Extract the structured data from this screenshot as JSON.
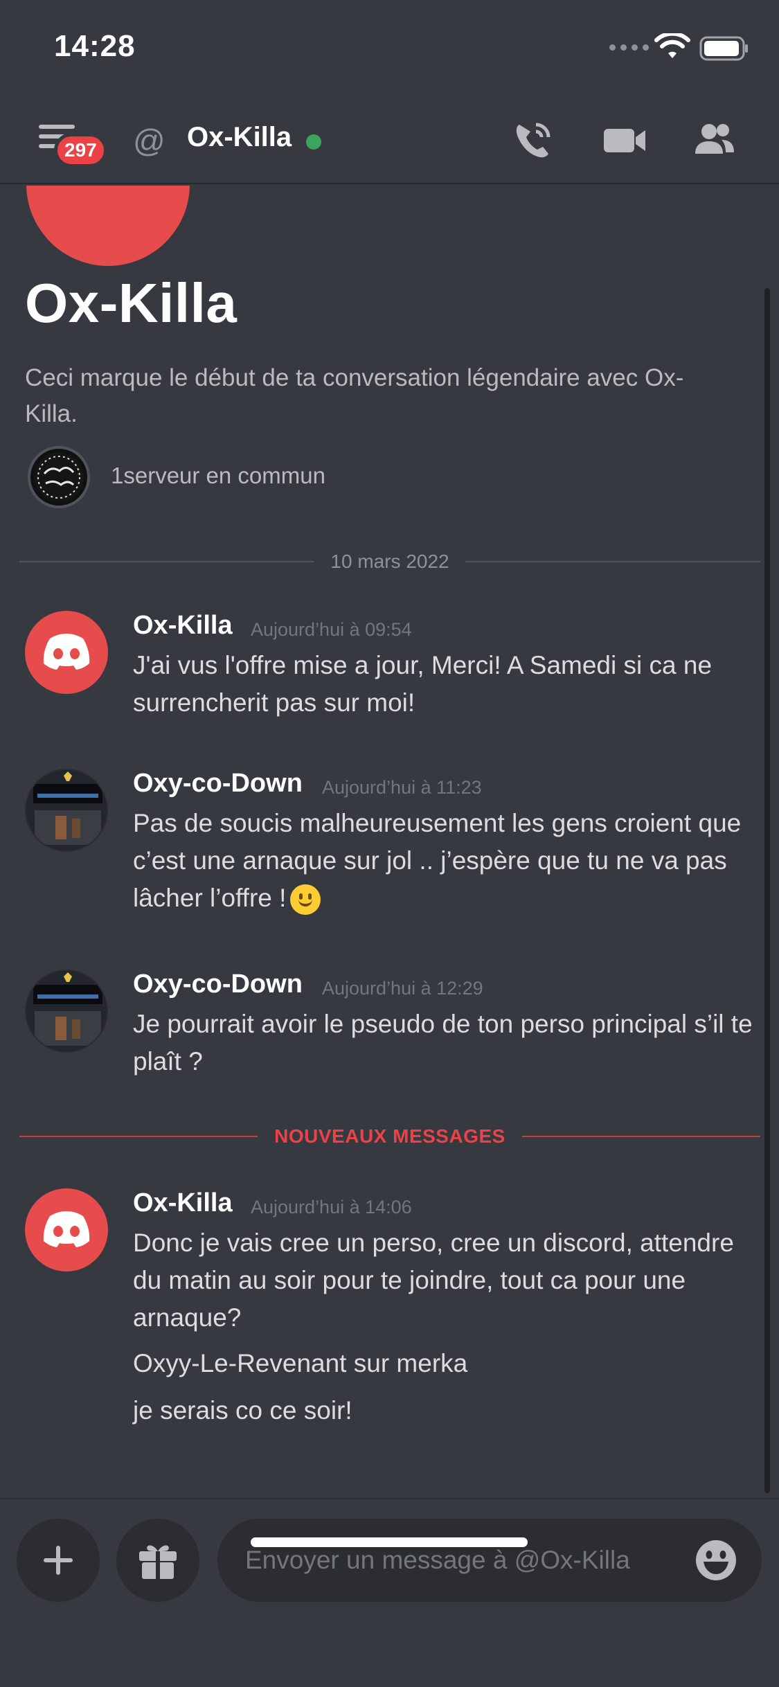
{
  "status_bar": {
    "time": "14:28"
  },
  "header": {
    "badge_count": "297",
    "at_symbol": "@",
    "name": "Ox-Killa",
    "icons": [
      "menu-icon",
      "at-icon",
      "phone-icon",
      "video-icon",
      "members-icon"
    ]
  },
  "profile": {
    "name": "Ox-Killa",
    "intro": "Ceci marque le début de ta conversation légendaire avec Ox-Killa.",
    "mutual_servers": "1serveur en commun"
  },
  "date_divider": "10 mars 2022",
  "new_messages_divider": "NOUVEAUX MESSAGES",
  "messages": [
    {
      "author": "Ox-Killa",
      "timestamp": "Aujourd’hui à 09:54",
      "text": "J'ai vus l'offre mise a jour, Merci! A Samedi si ca ne surrencherit pas sur moi!"
    },
    {
      "author": "Oxy-co-Down",
      "timestamp": "Aujourd’hui à 11:23",
      "text": "Pas de soucis malheureusement les gens croient que c’est une arnaque sur jol .. j’espère que tu ne va pas lâcher l’offre !"
    },
    {
      "author": "Oxy-co-Down",
      "timestamp": "Aujourd’hui à 12:29",
      "text": "Je pourrait avoir le pseudo de ton perso principal s’il te plaît ?"
    },
    {
      "author": "Ox-Killa",
      "timestamp": "Aujourd’hui à 14:06",
      "text": "Donc je vais cree un perso, cree un discord, attendre du matin au soir pour te joindre, tout ca pour une arnaque?",
      "followups": [
        "Oxyy-Le-Revenant sur merka",
        "je serais co ce soir!"
      ]
    }
  ],
  "composer": {
    "placeholder": "Envoyer un message à @Ox-Killa"
  },
  "colors": {
    "background": "#36393f",
    "accent_red": "#ed4245",
    "online": "#3ba55d",
    "discord_avatar": "#e74c4c"
  }
}
